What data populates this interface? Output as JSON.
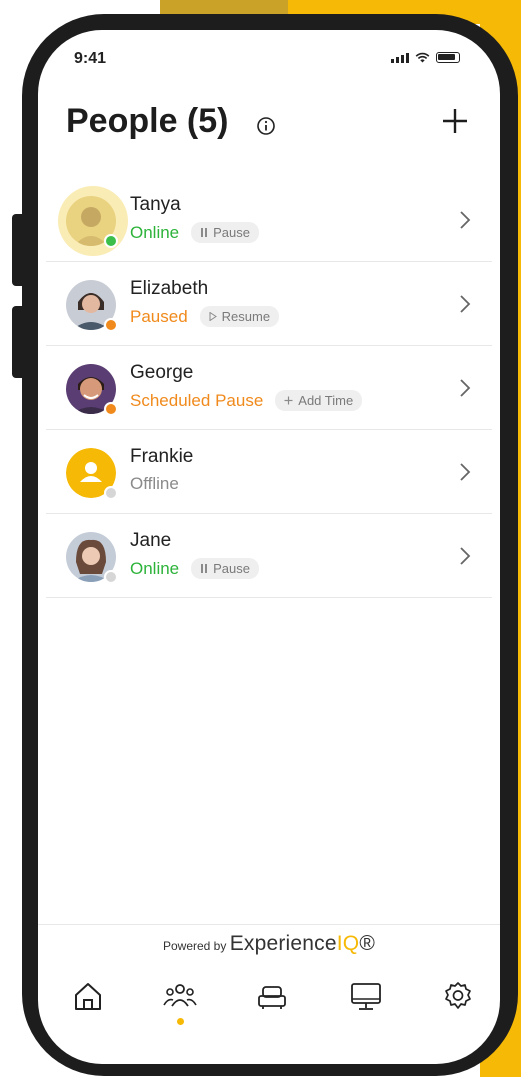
{
  "status_bar": {
    "time": "9:41"
  },
  "header": {
    "title": "People (5)"
  },
  "people": [
    {
      "name": "Tanya",
      "status": "Online",
      "status_color": "#2db33a",
      "action": "Pause",
      "action_icon": "pause-icon",
      "dot_color": "#3cbf4a"
    },
    {
      "name": "Elizabeth",
      "status": "Paused",
      "status_color": "#f08a1c",
      "action": "Resume",
      "action_icon": "play-icon",
      "dot_color": "#f08a1c"
    },
    {
      "name": "George",
      "status": "Scheduled Pause",
      "status_color": "#f08a1c",
      "action": "Add Time",
      "action_icon": "plus-icon",
      "dot_color": "#f08a1c"
    },
    {
      "name": "Frankie",
      "status": "Offline",
      "status_color": "#8a8a8a",
      "action": "",
      "action_icon": "",
      "dot_color": "#d6d6d6"
    },
    {
      "name": "Jane",
      "status": "Online",
      "status_color": "#2db33a",
      "action": "Pause",
      "action_icon": "pause-icon",
      "dot_color": "#d6d6d6"
    }
  ],
  "footer": {
    "powered_by": "Powered by",
    "brand_main": "Experience",
    "brand_iq": "IQ",
    "brand_mark": "®"
  },
  "tabs": [
    {
      "icon": "home-icon"
    },
    {
      "icon": "people-icon",
      "active": true
    },
    {
      "icon": "car-icon"
    },
    {
      "icon": "monitor-icon"
    },
    {
      "icon": "settings-icon"
    }
  ],
  "colors": {
    "accent": "#f6b906",
    "online": "#2db33a",
    "paused": "#f08a1c",
    "offline": "#8a8a8a"
  }
}
